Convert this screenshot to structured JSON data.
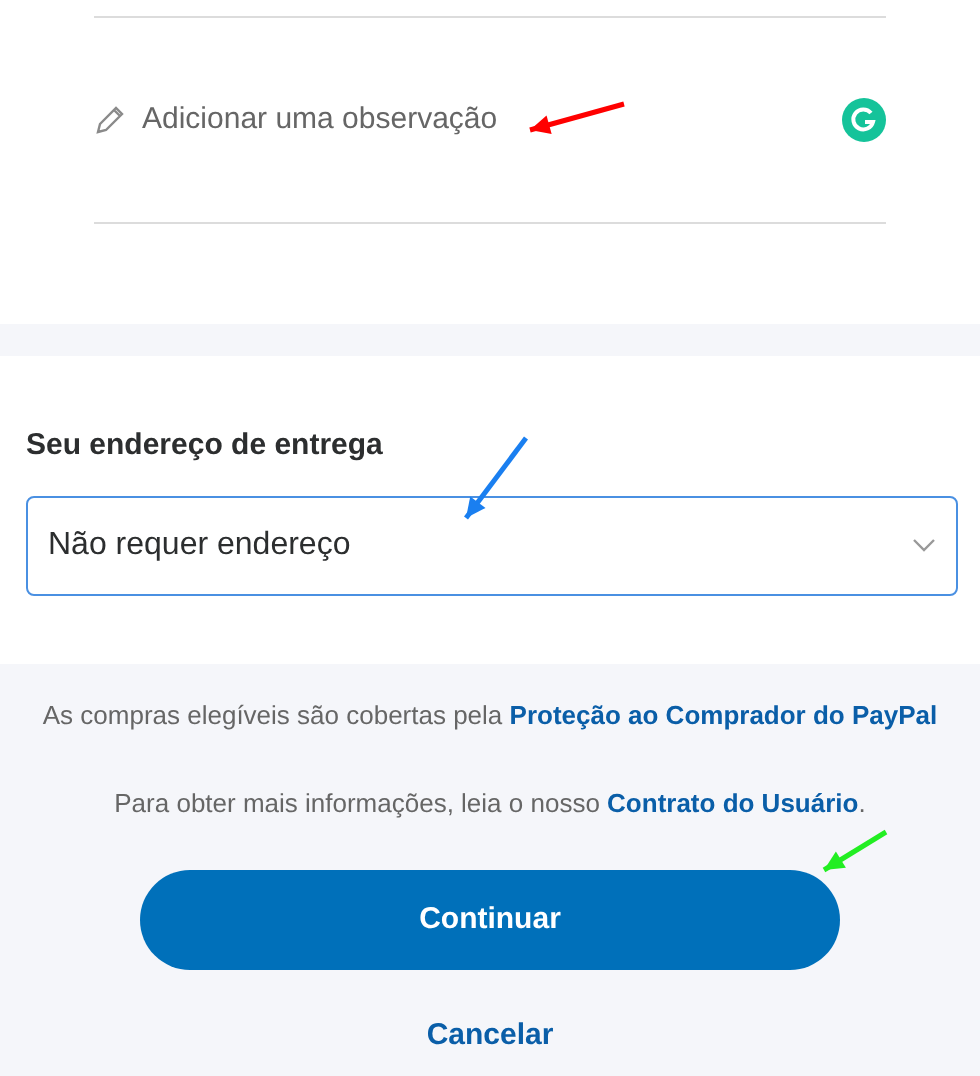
{
  "note": {
    "placeholder": "Adicionar uma observação"
  },
  "shipping": {
    "heading": "Seu endereço de entrega",
    "select": {
      "value": "Não requer endereço"
    }
  },
  "notices": [
    {
      "text": "As compras elegíveis são cobertas pela ",
      "link": "Proteção ao Comprador do PayPal"
    },
    {
      "text": "Para obter mais informações, leia o nosso ",
      "link": "Contrato do Usuário",
      "after": "."
    }
  ],
  "buttons": {
    "primary": "Continuar",
    "secondary": "Cancelar"
  },
  "annotations": [
    {
      "color": "#ff0000"
    },
    {
      "color": "#1a7ff0"
    },
    {
      "color": "#22ee22"
    }
  ]
}
